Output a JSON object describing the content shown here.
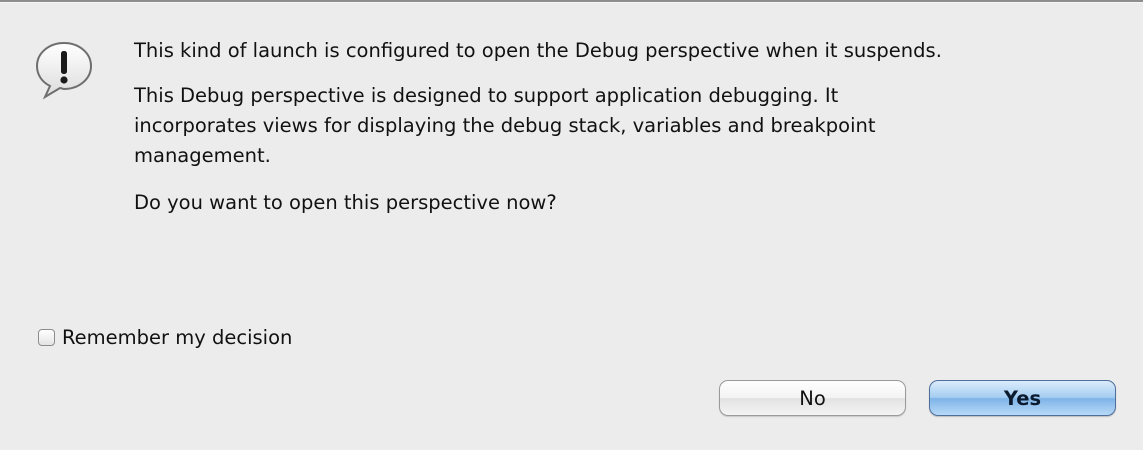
{
  "dialog": {
    "icon": "alert-speech-bubble-icon",
    "message": {
      "main": "This kind of launch is configured to open the Debug perspective when it suspends.",
      "detail_lines": [
        "This Debug perspective is designed to support application debugging.  It",
        "incorporates views for displaying the debug stack, variables and breakpoint",
        "management."
      ],
      "question": "Do you want to open this perspective now?"
    },
    "remember_checkbox": {
      "label": "Remember my decision",
      "checked": false
    },
    "buttons": {
      "no_label": "No",
      "yes_label": "Yes",
      "default": "Yes"
    },
    "colors": {
      "background": "#ececec",
      "default_button": "#7fb4e8"
    }
  }
}
